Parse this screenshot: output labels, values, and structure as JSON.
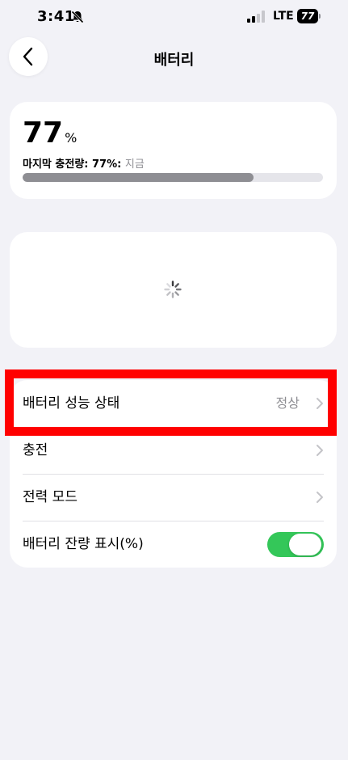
{
  "status_bar": {
    "time": "3:41",
    "carrier": "LTE",
    "battery_level": "77"
  },
  "nav": {
    "title": "배터리",
    "back_icon": "chevron-left-icon"
  },
  "battery_level": {
    "value": "77",
    "unit": "%",
    "last_charge_label": "마지막 충전량: 77%:",
    "last_charge_time": "지금",
    "fill_fraction": 0.77
  },
  "settings": {
    "rows": [
      {
        "label": "배터리 성능 상태",
        "value": "정상"
      },
      {
        "label": "충전"
      },
      {
        "label": "전력 모드"
      },
      {
        "label": "배터리 잔량 표시(%)",
        "toggle_on": true
      }
    ]
  },
  "colors": {
    "accent_green": "#34c759",
    "highlight_red": "#ff0000",
    "secondary_text": "#8e8e93",
    "background": "#f2f2f7"
  }
}
